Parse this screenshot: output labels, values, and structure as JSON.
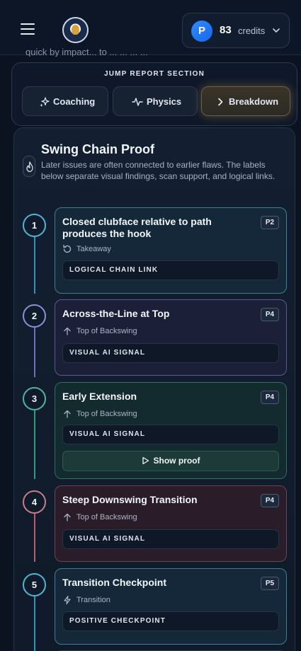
{
  "header": {
    "avatar_initial": "P",
    "credits_count": "83",
    "credits_label": "credits"
  },
  "partial_text": "quick by impact... to ... ... ... ...",
  "jump": {
    "title": "JUMP REPORT SECTION",
    "tabs": [
      {
        "label": "Coaching",
        "icon": "sparkles-icon"
      },
      {
        "label": "Physics",
        "icon": "pulse-icon"
      },
      {
        "label": "Breakdown",
        "icon": "chevron-right-icon",
        "active": true
      }
    ]
  },
  "card": {
    "title": "Swing Chain Proof",
    "description": "Later issues are often connected to earlier flaws. The labels below separate visual findings, scan support, and logical links.",
    "icon": "flame-icon"
  },
  "steps": [
    {
      "number": "1",
      "title": "Closed clubface relative to path produces the hook",
      "priority": "P2",
      "phase": "Takeaway",
      "phase_icon": "rotate-icon",
      "tag": "LOGICAL CHAIN LINK",
      "color": "#4fb7d6"
    },
    {
      "number": "2",
      "title": "Across-the-Line at Top",
      "priority": "P4",
      "phase": "Top of Backswing",
      "phase_icon": "arrow-up-icon",
      "tag": "VISUAL AI SIGNAL",
      "color": "#8f8fd8"
    },
    {
      "number": "3",
      "title": "Early Extension",
      "priority": "P4",
      "phase": "Top of Backswing",
      "phase_icon": "arrow-up-icon",
      "tag": "VISUAL AI SIGNAL",
      "button": "Show proof",
      "color": "#4bb89e"
    },
    {
      "number": "4",
      "title": "Steep Downswing Transition",
      "priority": "P4",
      "phase": "Top of Backswing",
      "phase_icon": "arrow-up-icon",
      "tag": "VISUAL AI SIGNAL",
      "color": "#c97d8c"
    },
    {
      "number": "5",
      "title": "Transition Checkpoint",
      "priority": "P5",
      "phase": "Transition",
      "phase_icon": "bolt-icon",
      "tag": "POSITIVE CHECKPOINT",
      "color": "#4fb7d6"
    }
  ]
}
